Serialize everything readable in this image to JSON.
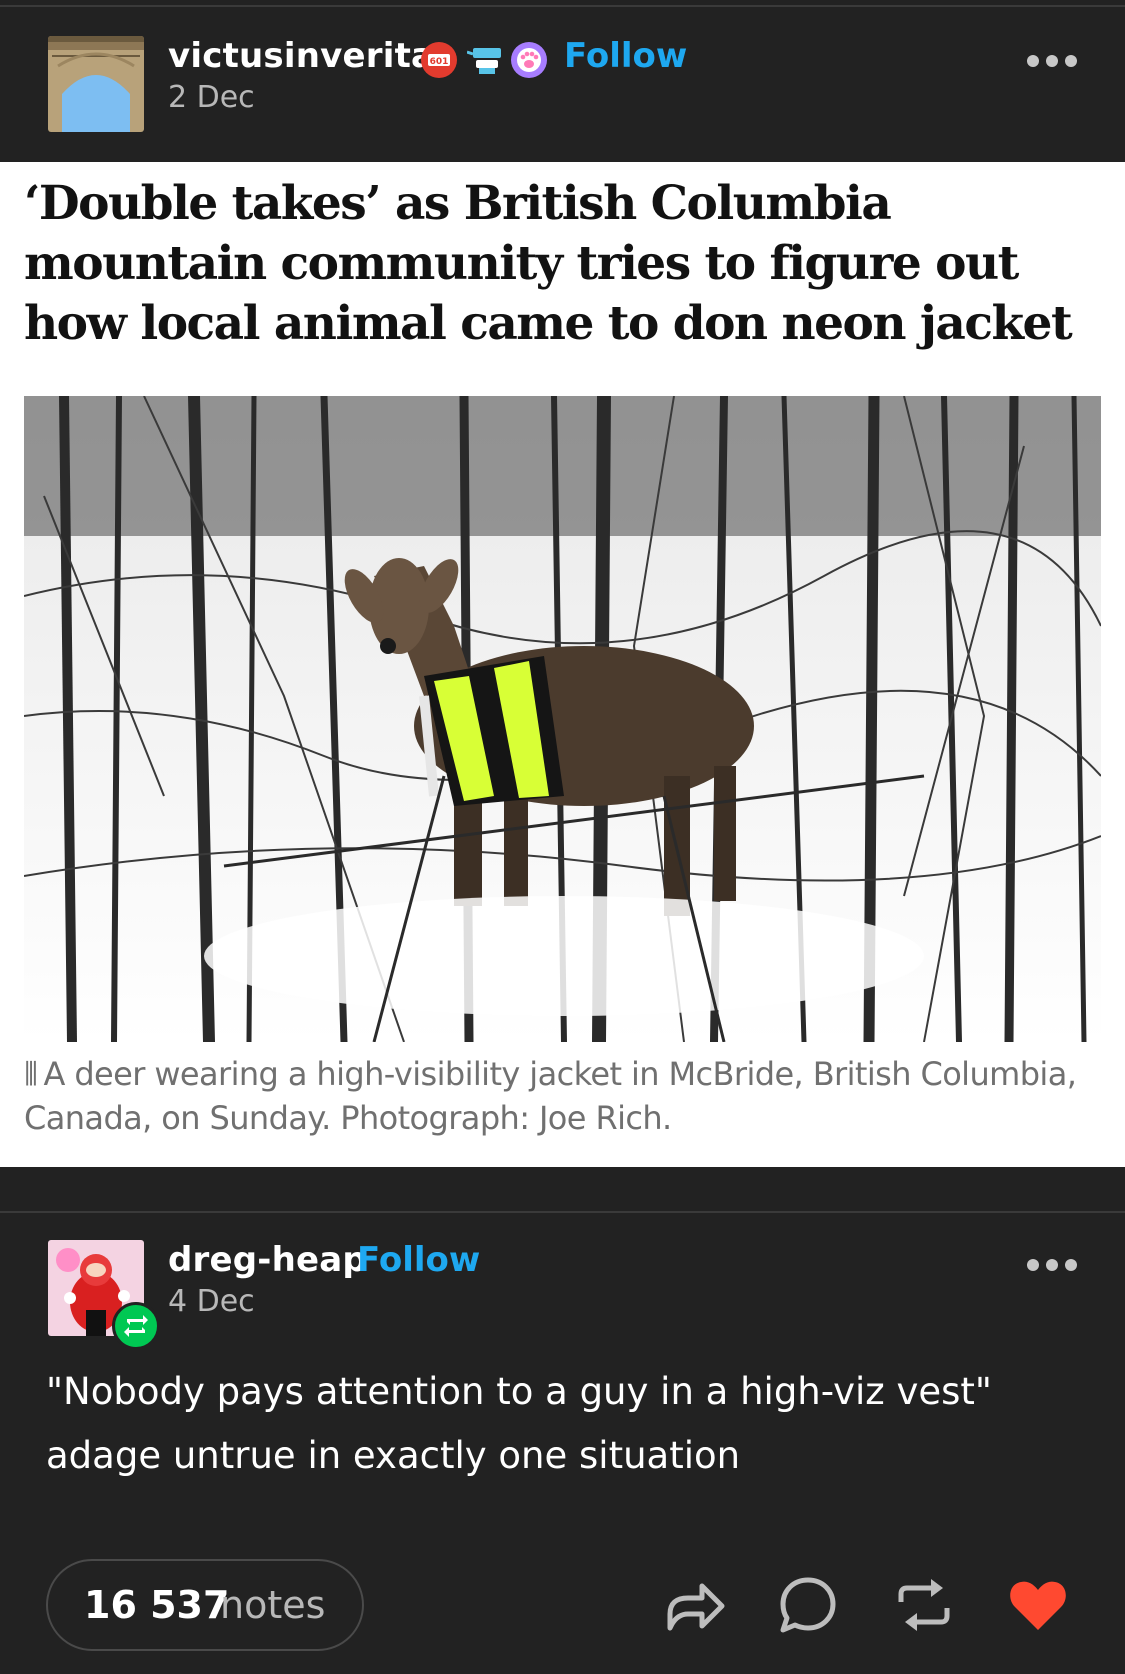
{
  "post": {
    "username": "victusinveritas",
    "date": "2 Dec",
    "follow_label": "Follow",
    "badges": [
      "stamp-badge-icon",
      "robot-badge-icon",
      "paw-badge-icon"
    ],
    "badge_text": "601"
  },
  "article": {
    "headline": "‘Double takes’ as British Columbia mountain community tries to figure out how local animal came to don neon jacket",
    "photo_subject": "deer-in-high-visibility-jacket",
    "caption": "A deer wearing a high-visibility jacket in McBride, British Columbia, Canada, on Sunday. Photograph: Joe Rich.",
    "caption_mark": "⦀"
  },
  "reblog": {
    "username": "dreg-heap",
    "date": "4 Dec",
    "follow_label": "Follow",
    "text": "\"Nobody pays attention to a guy in a high-viz vest\" adage untrue in exactly one situation"
  },
  "footer": {
    "notes_count": "16 537",
    "notes_label": "notes",
    "actions": [
      "share-icon",
      "comment-icon",
      "reblog-icon",
      "like-icon"
    ]
  },
  "colors": {
    "background": "#222222",
    "follow": "#1ea8f0",
    "like": "#ff4930",
    "reblog_badge": "#00c853"
  }
}
